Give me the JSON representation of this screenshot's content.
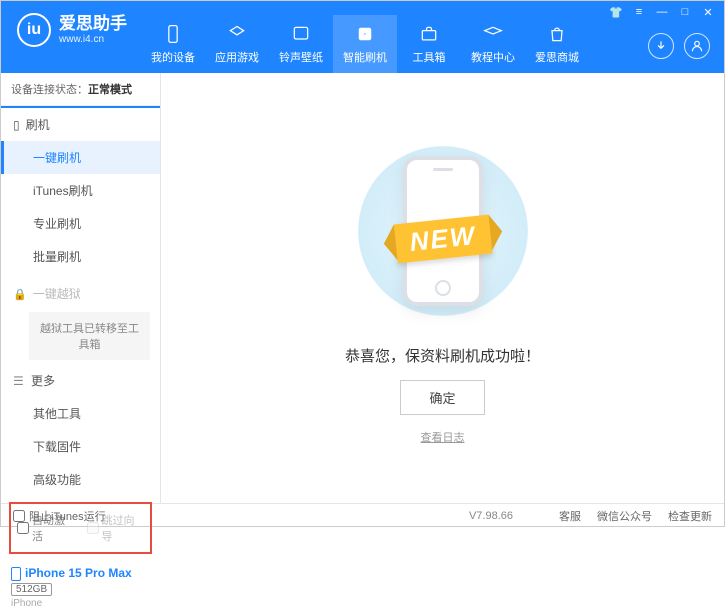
{
  "brand": {
    "title": "爱思助手",
    "subtitle": "www.i4.cn",
    "logo": "iu"
  },
  "titlebar": {
    "skin": "👕",
    "menu": "≡",
    "min": "—",
    "max": "□",
    "close": "✕"
  },
  "nav": {
    "items": [
      {
        "label": "我的设备"
      },
      {
        "label": "应用游戏"
      },
      {
        "label": "铃声壁纸"
      },
      {
        "label": "智能刷机",
        "active": true
      },
      {
        "label": "工具箱"
      },
      {
        "label": "教程中心"
      },
      {
        "label": "爱思商城"
      }
    ]
  },
  "sidebar": {
    "status_label": "设备连接状态：",
    "status_value": "正常模式",
    "section_flash": "刷机",
    "items_flash": [
      "一键刷机",
      "iTunes刷机",
      "专业刷机",
      "批量刷机"
    ],
    "section_jailbreak": "一键越狱",
    "jailbreak_note": "越狱工具已转移至工具箱",
    "section_more": "更多",
    "items_more": [
      "其他工具",
      "下载固件",
      "高级功能"
    ],
    "checkbox_auto_activate": "自动激活",
    "checkbox_skip_setup": "跳过向导",
    "device": {
      "name": "iPhone 15 Pro Max",
      "storage": "512GB",
      "model": "iPhone"
    }
  },
  "main": {
    "ribbon": "NEW",
    "success": "恭喜您，保资料刷机成功啦！",
    "confirm": "确定",
    "view_log": "查看日志"
  },
  "footer": {
    "block_itunes": "阻止iTunes运行",
    "version": "V7.98.66",
    "links": [
      "客服",
      "微信公众号",
      "检查更新"
    ]
  }
}
